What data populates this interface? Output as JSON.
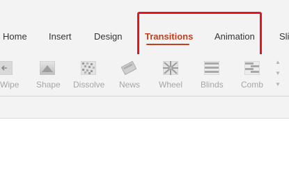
{
  "tabs": [
    {
      "label": "Home"
    },
    {
      "label": "Insert"
    },
    {
      "label": "Design"
    },
    {
      "label": "Transitions",
      "active": true
    },
    {
      "label": "Animation"
    },
    {
      "label": "Sli"
    }
  ],
  "transitions_gallery": [
    {
      "label": "Wipe",
      "icon": "wipe-icon"
    },
    {
      "label": "Shape",
      "icon": "shape-icon"
    },
    {
      "label": "Dissolve",
      "icon": "dissolve-icon"
    },
    {
      "label": "News",
      "icon": "news-icon"
    },
    {
      "label": "Wheel",
      "icon": "wheel-icon"
    },
    {
      "label": "Blinds",
      "icon": "blinds-icon"
    },
    {
      "label": "Comb",
      "icon": "comb-icon"
    }
  ],
  "colors": {
    "active_tab": "#c43e1c",
    "highlight": "#e8141c",
    "ribbon_bg": "#f3f3f3",
    "disabled_text": "#a6a6a6"
  }
}
